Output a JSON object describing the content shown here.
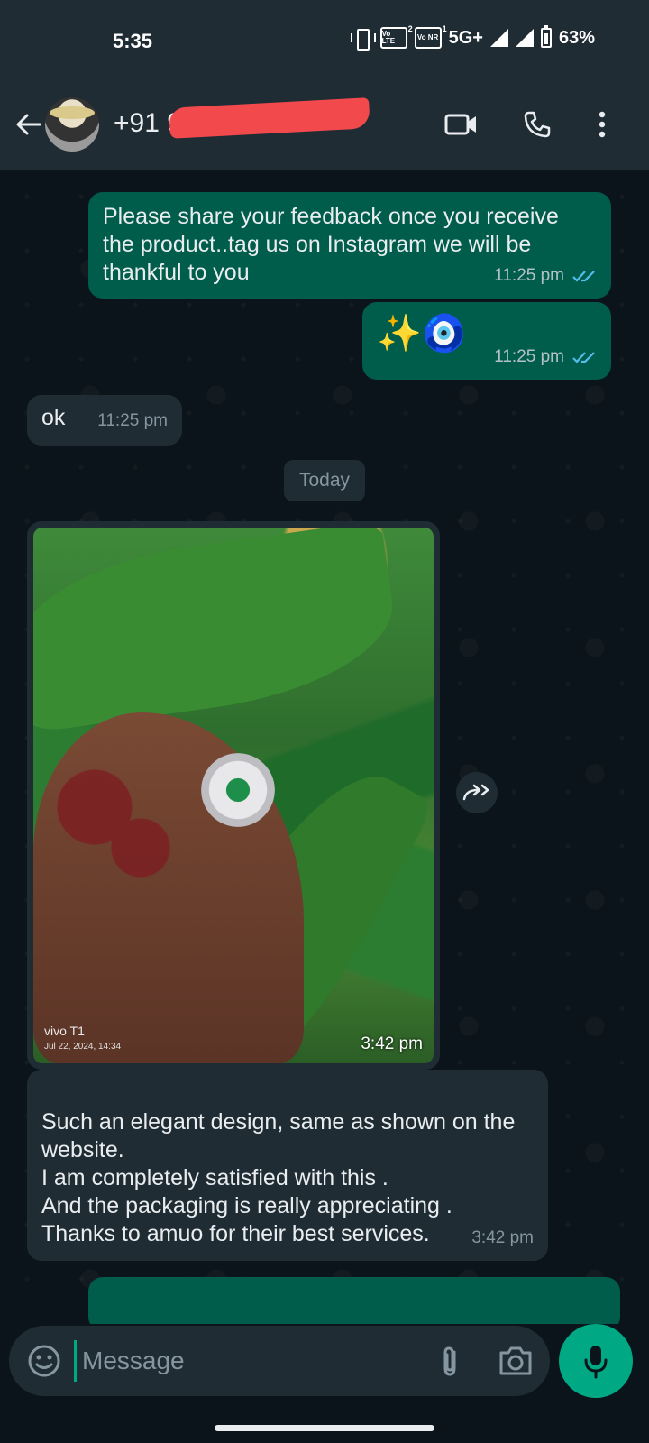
{
  "status_bar": {
    "time": "5:35",
    "sim1": "Vo LTE",
    "sim1_num": "2",
    "sim2": "Vo NR",
    "sim2_num": "1",
    "network": "5G+",
    "battery": "63%"
  },
  "header": {
    "contact": "+91 91",
    "icons": [
      "back-arrow-icon",
      "video-call-icon",
      "voice-call-icon",
      "more-options-icon"
    ]
  },
  "messages": [
    {
      "direction": "out",
      "text": "Please share your feedback once you receive the product..tag us on Instagram we will be thankful to you",
      "time": "11:25 pm",
      "status": "read"
    },
    {
      "direction": "out",
      "text": "✨🧿",
      "time": "11:25 pm",
      "status": "read"
    },
    {
      "direction": "in",
      "text": "ok",
      "time": "11:25 pm"
    },
    {
      "direction": "date",
      "text": "Today"
    },
    {
      "direction": "in",
      "type": "image",
      "caption_watermark": "vivo T1",
      "watermark_date": "Jul 22, 2024, 14:34",
      "time": "3:42 pm"
    },
    {
      "direction": "in",
      "text": "Such an elegant design, same as shown on the website.\nI am completely satisfied with this .\nAnd the packaging is really appreciating .\nThanks to amuo for their best services.",
      "time": "3:42 pm"
    }
  ],
  "composer": {
    "placeholder": "Message"
  },
  "colors": {
    "outgoing": "#005c4b",
    "incoming": "#1f2c34",
    "accent": "#00a884",
    "read_ticks": "#53bdeb"
  }
}
